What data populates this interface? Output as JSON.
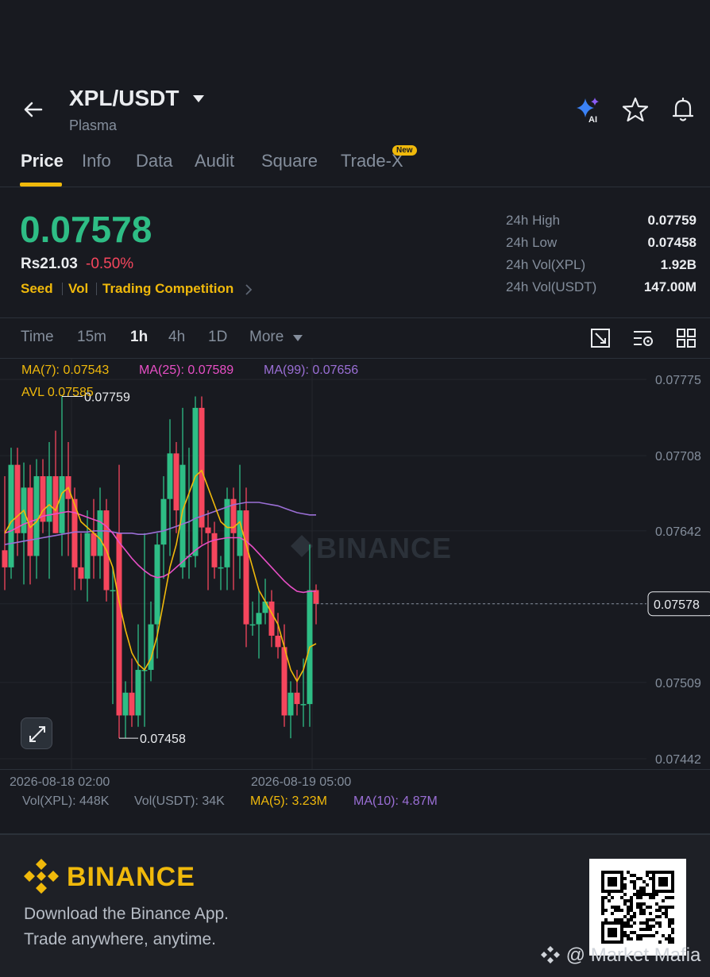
{
  "header": {
    "title": "XPL/USDT",
    "subtitle": "Plasma",
    "icons": [
      "back-arrow-icon",
      "caret-down-icon",
      "ai-sparkle-icon",
      "star-icon",
      "bell-icon"
    ],
    "ai_label": "AI"
  },
  "tabs": [
    {
      "label": "Price",
      "active": true
    },
    {
      "label": "Info",
      "active": false
    },
    {
      "label": "Data",
      "active": false
    },
    {
      "label": "Audit",
      "active": false
    },
    {
      "label": "Square",
      "active": false
    },
    {
      "label": "Trade-X",
      "active": false
    }
  ],
  "new_badge": "New",
  "ticker": {
    "last_price": "0.07578",
    "fiat": "Rs21.03",
    "change": "-0.50%",
    "tags": [
      "Seed",
      "Vol",
      "Trading Competition"
    ],
    "stats": [
      {
        "label": "24h High",
        "value": "0.07759"
      },
      {
        "label": "24h Low",
        "value": "0.07458"
      },
      {
        "label": "24h Vol(XPL)",
        "value": "1.92B"
      },
      {
        "label": "24h Vol(USDT)",
        "value": "147.00M"
      }
    ]
  },
  "intervals": [
    {
      "label": "Time",
      "active": false
    },
    {
      "label": "15m",
      "active": false
    },
    {
      "label": "1h",
      "active": true
    },
    {
      "label": "4h",
      "active": false
    },
    {
      "label": "1D",
      "active": false
    },
    {
      "label": "More",
      "active": false
    }
  ],
  "chart_tools": [
    "chart-settings-icon",
    "indicator-settings-icon",
    "layout-grid-icon"
  ],
  "chart_indicators": {
    "ma7": "MA(7): 0.07543",
    "ma25": "MA(25): 0.07589",
    "ma99": "MA(99): 0.07656",
    "avl": "AVL 0.07585",
    "vol_xpl": "Vol(XPL): 448K",
    "vol_usdt": "Vol(USDT): 34K",
    "vol_ma5": "MA(5): 3.23M",
    "vol_ma10": "MA(10): 4.87M"
  },
  "colors": {
    "up": "#2ebd85",
    "down": "#f6465d",
    "ma7": "#f0b90b",
    "ma25": "#e84fc6",
    "ma99": "#9b6fd6",
    "accent": "#f0b90b"
  },
  "chart_data": {
    "type": "candlestick",
    "y_ticks": [
      "0.07775",
      "0.07708",
      "0.07642",
      "0.07578",
      "0.07509",
      "0.07442"
    ],
    "ylim": [
      0.07442,
      0.07775
    ],
    "x_ticks": [
      "2026-08-18 02:00",
      "2026-08-19 05:00"
    ],
    "last_price_label": "0.07578",
    "high_marker": "0.07759",
    "low_marker": "0.07458",
    "candles": [
      {
        "o": 0.07625,
        "h": 0.0769,
        "l": 0.0759,
        "c": 0.0761
      },
      {
        "o": 0.0761,
        "h": 0.07715,
        "l": 0.076,
        "c": 0.077
      },
      {
        "o": 0.077,
        "h": 0.07715,
        "l": 0.0762,
        "c": 0.0764
      },
      {
        "o": 0.0764,
        "h": 0.07702,
        "l": 0.07595,
        "c": 0.0768
      },
      {
        "o": 0.0768,
        "h": 0.077,
        "l": 0.07595,
        "c": 0.0762
      },
      {
        "o": 0.0762,
        "h": 0.07705,
        "l": 0.076,
        "c": 0.0769
      },
      {
        "o": 0.0769,
        "h": 0.07705,
        "l": 0.0764,
        "c": 0.0765
      },
      {
        "o": 0.0765,
        "h": 0.0772,
        "l": 0.076,
        "c": 0.0769
      },
      {
        "o": 0.0769,
        "h": 0.0773,
        "l": 0.0764,
        "c": 0.0764
      },
      {
        "o": 0.0764,
        "h": 0.0776,
        "l": 0.0762,
        "c": 0.0769
      },
      {
        "o": 0.0769,
        "h": 0.0772,
        "l": 0.0762,
        "c": 0.0767
      },
      {
        "o": 0.0767,
        "h": 0.0768,
        "l": 0.0759,
        "c": 0.0761
      },
      {
        "o": 0.0761,
        "h": 0.0764,
        "l": 0.0759,
        "c": 0.076
      },
      {
        "o": 0.076,
        "h": 0.0766,
        "l": 0.0758,
        "c": 0.0764
      },
      {
        "o": 0.0764,
        "h": 0.0767,
        "l": 0.076,
        "c": 0.0762
      },
      {
        "o": 0.0762,
        "h": 0.0768,
        "l": 0.076,
        "c": 0.0766
      },
      {
        "o": 0.0766,
        "h": 0.0767,
        "l": 0.0758,
        "c": 0.0759
      },
      {
        "o": 0.0759,
        "h": 0.0761,
        "l": 0.0749,
        "c": 0.0759
      },
      {
        "o": 0.0764,
        "h": 0.077,
        "l": 0.0746,
        "c": 0.0748
      },
      {
        "o": 0.0748,
        "h": 0.0751,
        "l": 0.0746,
        "c": 0.075
      },
      {
        "o": 0.075,
        "h": 0.0753,
        "l": 0.0747,
        "c": 0.0748
      },
      {
        "o": 0.0748,
        "h": 0.0756,
        "l": 0.0747,
        "c": 0.0752
      },
      {
        "o": 0.0752,
        "h": 0.0764,
        "l": 0.0747,
        "c": 0.0752
      },
      {
        "o": 0.0752,
        "h": 0.0758,
        "l": 0.0751,
        "c": 0.0756
      },
      {
        "o": 0.0756,
        "h": 0.0764,
        "l": 0.0753,
        "c": 0.0763
      },
      {
        "o": 0.0763,
        "h": 0.0769,
        "l": 0.076,
        "c": 0.0767
      },
      {
        "o": 0.0767,
        "h": 0.0774,
        "l": 0.0762,
        "c": 0.0771
      },
      {
        "o": 0.0771,
        "h": 0.0772,
        "l": 0.0764,
        "c": 0.0766
      },
      {
        "o": 0.0761,
        "h": 0.0775,
        "l": 0.076,
        "c": 0.077
      },
      {
        "o": 0.0762,
        "h": 0.07715,
        "l": 0.076,
        "c": 0.0762
      },
      {
        "o": 0.0762,
        "h": 0.0776,
        "l": 0.0761,
        "c": 0.0775
      },
      {
        "o": 0.0775,
        "h": 0.0776,
        "l": 0.0763,
        "c": 0.07645
      },
      {
        "o": 0.07645,
        "h": 0.0766,
        "l": 0.0759,
        "c": 0.0764
      },
      {
        "o": 0.0764,
        "h": 0.0765,
        "l": 0.076,
        "c": 0.0761
      },
      {
        "o": 0.0761,
        "h": 0.0762,
        "l": 0.0759,
        "c": 0.0761
      },
      {
        "o": 0.0761,
        "h": 0.0768,
        "l": 0.0759,
        "c": 0.0767
      },
      {
        "o": 0.0767,
        "h": 0.0768,
        "l": 0.0759,
        "c": 0.0764
      },
      {
        "o": 0.0762,
        "h": 0.077,
        "l": 0.076,
        "c": 0.0766
      },
      {
        "o": 0.0766,
        "h": 0.0768,
        "l": 0.0754,
        "c": 0.0756
      },
      {
        "o": 0.0756,
        "h": 0.0758,
        "l": 0.0755,
        "c": 0.0756
      },
      {
        "o": 0.0756,
        "h": 0.0759,
        "l": 0.0753,
        "c": 0.0757
      },
      {
        "o": 0.0757,
        "h": 0.076,
        "l": 0.0756,
        "c": 0.0758
      },
      {
        "o": 0.0758,
        "h": 0.0759,
        "l": 0.0754,
        "c": 0.0755
      },
      {
        "o": 0.0755,
        "h": 0.0757,
        "l": 0.0753,
        "c": 0.0754
      },
      {
        "o": 0.0754,
        "h": 0.0756,
        "l": 0.0747,
        "c": 0.0748
      },
      {
        "o": 0.0748,
        "h": 0.0751,
        "l": 0.0746,
        "c": 0.075
      },
      {
        "o": 0.075,
        "h": 0.0752,
        "l": 0.0748,
        "c": 0.0749
      },
      {
        "o": 0.0749,
        "h": 0.0753,
        "l": 0.0747,
        "c": 0.0749
      },
      {
        "o": 0.0749,
        "h": 0.0763,
        "l": 0.0747,
        "c": 0.0759
      },
      {
        "o": 0.0759,
        "h": 0.07595,
        "l": 0.0756,
        "c": 0.07578
      }
    ],
    "ma7": [
      0.0764,
      0.0765,
      0.07655,
      0.0766,
      0.07645,
      0.0765,
      0.0766,
      0.07665,
      0.0766,
      0.07675,
      0.0768,
      0.07665,
      0.0765,
      0.07645,
      0.0764,
      0.07635,
      0.07625,
      0.0761,
      0.0758,
      0.07555,
      0.07535,
      0.07525,
      0.0752,
      0.0753,
      0.0755,
      0.0758,
      0.0761,
      0.0763,
      0.0766,
      0.07675,
      0.0769,
      0.07695,
      0.0768,
      0.07665,
      0.0765,
      0.07645,
      0.07645,
      0.0765,
      0.0763,
      0.0761,
      0.0759,
      0.0758,
      0.0757,
      0.0756,
      0.0754,
      0.0752,
      0.0751,
      0.0752,
      0.0754,
      0.07543
    ],
    "ma25": [
      0.0764,
      0.07642,
      0.07645,
      0.07648,
      0.0765,
      0.07652,
      0.07655,
      0.07656,
      0.07657,
      0.07658,
      0.07659,
      0.07658,
      0.07656,
      0.07654,
      0.07652,
      0.0765,
      0.07646,
      0.0764,
      0.07632,
      0.07625,
      0.07618,
      0.07612,
      0.07607,
      0.07603,
      0.07601,
      0.07602,
      0.07605,
      0.0761,
      0.07615,
      0.0762,
      0.07625,
      0.07629,
      0.07632,
      0.07634,
      0.07635,
      0.07636,
      0.07636,
      0.07636,
      0.07633,
      0.07628,
      0.07622,
      0.07616,
      0.0761,
      0.07604,
      0.07598,
      0.07593,
      0.07589,
      0.07588,
      0.07589,
      0.07589
    ],
    "ma99": [
      0.0763,
      0.07631,
      0.07632,
      0.07633,
      0.07634,
      0.07635,
      0.07636,
      0.07637,
      0.07638,
      0.07639,
      0.0764,
      0.07641,
      0.07641,
      0.07641,
      0.07642,
      0.07642,
      0.07642,
      0.07641,
      0.0764,
      0.0764,
      0.0764,
      0.07639,
      0.07639,
      0.0764,
      0.07641,
      0.07642,
      0.07644,
      0.07646,
      0.07648,
      0.0765,
      0.07653,
      0.07655,
      0.07657,
      0.07659,
      0.07661,
      0.07663,
      0.07665,
      0.07666,
      0.07667,
      0.07667,
      0.07667,
      0.07666,
      0.07665,
      0.07664,
      0.07662,
      0.0766,
      0.07658,
      0.07657,
      0.07656,
      0.07656
    ]
  },
  "brand": {
    "name": "BINANCE",
    "chart_watermark": "BINANCE",
    "tagline1": "Download the Binance App.",
    "tagline2": "Trade anywhere, anytime.",
    "credit": "@ Market Mafia"
  }
}
